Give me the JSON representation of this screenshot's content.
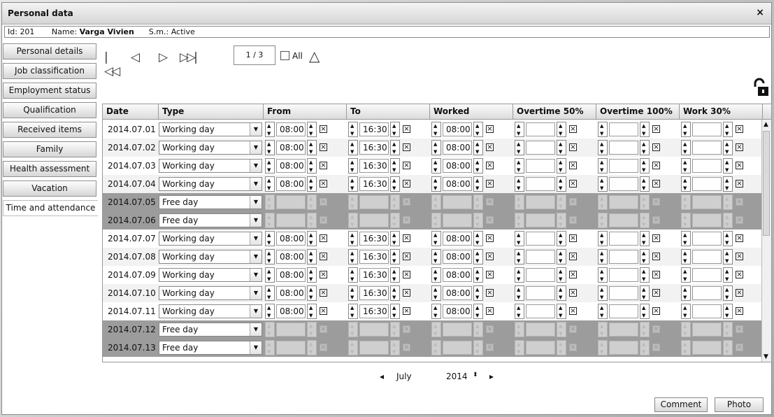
{
  "window": {
    "title": "Personal data",
    "close": "×"
  },
  "info": {
    "id_label": "Id:",
    "id": "201",
    "name_label": "Name:",
    "name": "Varga Vivien",
    "sm_label": "S.m.:",
    "status": "Active"
  },
  "sidebar": {
    "items": [
      {
        "label": "Personal details"
      },
      {
        "label": "Job classification"
      },
      {
        "label": "Employment status"
      },
      {
        "label": "Qualification"
      },
      {
        "label": "Received items"
      },
      {
        "label": "Family"
      },
      {
        "label": "Health assessment"
      },
      {
        "label": "Vacation"
      },
      {
        "label": "Time and attendance",
        "active": true
      }
    ]
  },
  "toolbar": {
    "first": "|◁◁",
    "prev": "◁",
    "next": "▷",
    "last": "▷▷|",
    "page": "1 / 3",
    "all_label": "All"
  },
  "table": {
    "headers": [
      "Date",
      "Type",
      "From",
      "To",
      "Worked",
      "Overtime 50%",
      "Overtime 100%",
      "Work 30%"
    ],
    "rows": [
      {
        "date": "2014.07.01",
        "type": "Working day",
        "from": "08:00",
        "to": "16:30",
        "worked": "08:00"
      },
      {
        "date": "2014.07.02",
        "type": "Working day",
        "from": "08:00",
        "to": "16:30",
        "worked": "08:00"
      },
      {
        "date": "2014.07.03",
        "type": "Working day",
        "from": "08:00",
        "to": "16:30",
        "worked": "08:00"
      },
      {
        "date": "2014.07.04",
        "type": "Working day",
        "from": "08:00",
        "to": "16:30",
        "worked": "08:00"
      },
      {
        "date": "2014.07.05",
        "type": "Free day",
        "from": "",
        "to": "",
        "worked": ""
      },
      {
        "date": "2014.07.06",
        "type": "Free day",
        "from": "",
        "to": "",
        "worked": ""
      },
      {
        "date": "2014.07.07",
        "type": "Working day",
        "from": "08:00",
        "to": "16:30",
        "worked": "08:00"
      },
      {
        "date": "2014.07.08",
        "type": "Working day",
        "from": "08:00",
        "to": "16:30",
        "worked": "08:00"
      },
      {
        "date": "2014.07.09",
        "type": "Working day",
        "from": "08:00",
        "to": "16:30",
        "worked": "08:00"
      },
      {
        "date": "2014.07.10",
        "type": "Working day",
        "from": "08:00",
        "to": "16:30",
        "worked": "08:00"
      },
      {
        "date": "2014.07.11",
        "type": "Working day",
        "from": "08:00",
        "to": "16:30",
        "worked": "08:00"
      },
      {
        "date": "2014.07.12",
        "type": "Free day",
        "from": "",
        "to": "",
        "worked": ""
      },
      {
        "date": "2014.07.13",
        "type": "Free day",
        "from": "",
        "to": "",
        "worked": ""
      }
    ]
  },
  "month_nav": {
    "month": "July",
    "year": "2014"
  },
  "footer": {
    "comment": "Comment",
    "photo": "Photo"
  }
}
